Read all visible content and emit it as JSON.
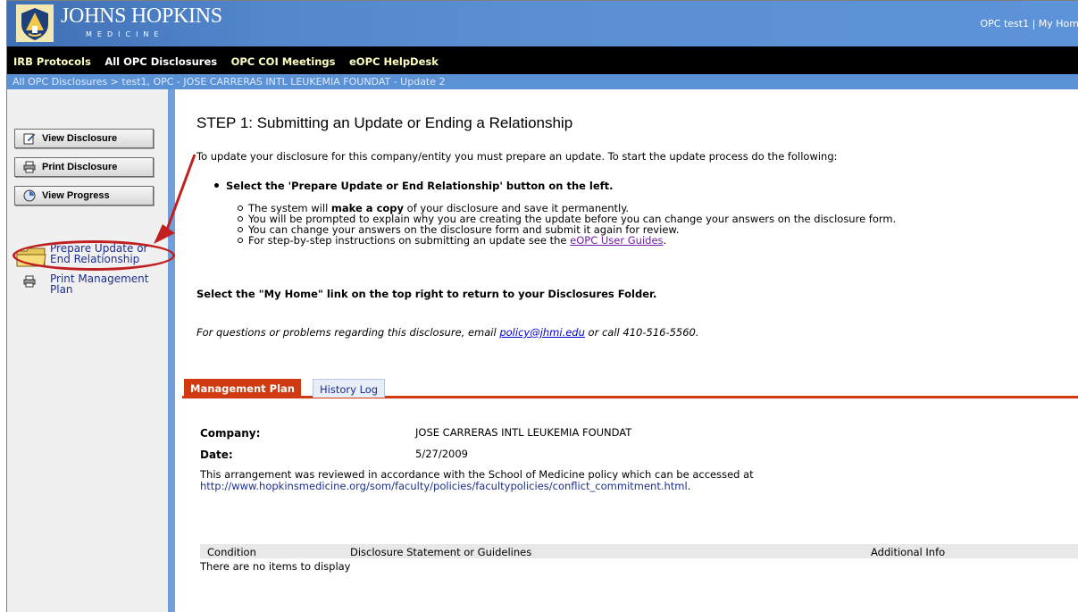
{
  "header": {
    "logo_text": "JOHNS HOPKINS",
    "logo_sub": "MEDICINE",
    "user_links": "OPC test1 | My Hom"
  },
  "topnav": {
    "items": [
      "IRB Protocols",
      "All OPC Disclosures",
      "OPC COI Meetings",
      "eOPC HelpDesk"
    ]
  },
  "breadcrumb": "All OPC Disclosures  >  test1, OPC - JOSE CARRERAS INTL LEUKEMIA FOUNDAT - Update 2",
  "sidebar": {
    "buttons": [
      "View Disclosure",
      "Print Disclosure",
      "View Progress"
    ],
    "links": {
      "prepare_line1": "Prepare Update or",
      "prepare_line2": "End Relationship",
      "print_plan_line1": "Print Management",
      "print_plan_line2": "Plan"
    }
  },
  "main": {
    "title": "STEP 1:  Submitting an Update or Ending a Relationship",
    "intro": "To update your disclosure for this company/entity you must prepare an update.  To start the update process do the following:",
    "bullet": "Select the 'Prepare Update or End Relationship' button on the left.",
    "sub1_pre": "The system will ",
    "sub1_bold": "make a copy",
    "sub1_post": " of your disclosure and save it permanently.",
    "sub2": "You will be prompted to explain why you are creating the update before you can change your answers on the disclosure form.",
    "sub3": "You can change your answers on the disclosure form and submit it again for review.",
    "sub4_pre": "For step-by-step instructions on submitting an update see the ",
    "sub4_link": "eOPC User Guides",
    "sub4_post": ".",
    "home_note": "Select the \"My Home\" link on the top right to return to your Disclosures Folder.",
    "contact_pre": "For questions or problems regarding this disclosure, email ",
    "contact_email": "policy@jhmi.edu",
    "contact_post": " or call 410-516-5560."
  },
  "tabs": [
    "Management Plan",
    "History Log"
  ],
  "plan": {
    "company_label": "Company:",
    "company_value": "JOSE CARRERAS INTL LEUKEMIA FOUNDAT",
    "date_label": "Date:",
    "date_value": "5/27/2009",
    "review_text": "This arrangement was reviewed in accordance with the School of Medicine policy which can be accessed at",
    "review_url": "http://www.hopkinsmedicine.org/som/faculty/policies/facultypolicies/conflict_commitment.html",
    "review_end": "."
  },
  "table": {
    "columns": [
      "Condition",
      "Disclosure Statement or Guidelines",
      "Additional Info"
    ],
    "empty": "There are no items to display"
  },
  "colors": {
    "header_blue": "#5b8fd2",
    "nav_black": "#000000",
    "tab_active": "#d13a10",
    "callout_red": "#c02020",
    "link_blue": "#1c2f8f"
  }
}
